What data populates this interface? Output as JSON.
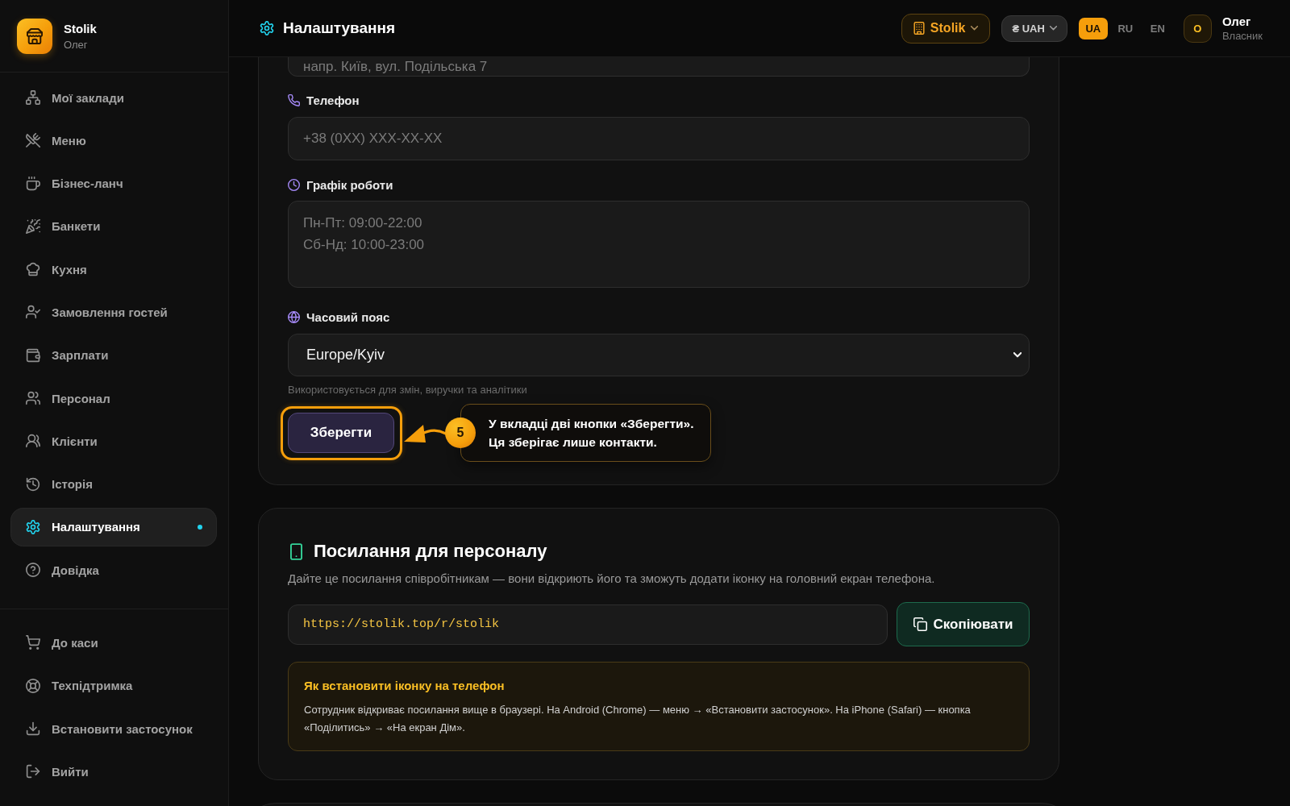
{
  "sidebar": {
    "brand": {
      "name": "Stolik",
      "user": "Олег"
    },
    "items": [
      {
        "label": "Мої заклади",
        "selected": false
      },
      {
        "label": "Меню",
        "selected": false
      },
      {
        "label": "Бізнес-ланч",
        "selected": false
      },
      {
        "label": "Банкети",
        "selected": false
      },
      {
        "label": "Кухня",
        "selected": false
      },
      {
        "label": "Замовлення гостей",
        "selected": false
      },
      {
        "label": "Зарплати",
        "selected": false
      },
      {
        "label": "Персонал",
        "selected": false
      },
      {
        "label": "Клієнти",
        "selected": false
      },
      {
        "label": "Історія",
        "selected": false
      },
      {
        "label": "Налаштування",
        "selected": true
      },
      {
        "label": "Довідка",
        "selected": false
      }
    ],
    "footer_items": [
      {
        "label": "До каси"
      },
      {
        "label": "Техпідтримка"
      },
      {
        "label": "Встановити застосунок"
      },
      {
        "label": "Вийти"
      }
    ]
  },
  "topbar": {
    "title": "Налаштування",
    "venue": {
      "label": "Stolik"
    },
    "currency": {
      "label": "₴ UAH"
    },
    "languages": [
      {
        "label": "UA",
        "selected": true
      },
      {
        "label": "RU",
        "selected": false
      },
      {
        "label": "EN",
        "selected": false
      }
    ],
    "user": {
      "initial": "О",
      "name": "Олег",
      "role": "Власник"
    }
  },
  "contacts_form": {
    "address": {
      "placeholder": "напр. Київ, вул. Подільська 7"
    },
    "phone": {
      "label": "Телефон",
      "placeholder": "+38 (0XX) XXX-XX-XX"
    },
    "hours": {
      "label": "Графік роботи",
      "placeholder": "Пн-Пт: 09:00-22:00\nСб-Нд: 10:00-23:00"
    },
    "timezone": {
      "label": "Часовий пояс",
      "value": "Europe/Kyiv",
      "hint": "Використовується для змін, виручки та аналітики"
    },
    "save_button": {
      "label": "Зберегти"
    }
  },
  "tour_hint": {
    "step": "5",
    "text": "У вкладці дві кнопки «Зберегти».\nЦя зберігає лише контакти."
  },
  "staff_link": {
    "title": "Посилання для персоналу",
    "description": "Дайте це посилання співробітникам — вони відкриють його та зможуть додати іконку на головний екран телефона.",
    "url": "https://stolik.top/r/stolik",
    "copy_button": {
      "label": "Скопіювати"
    },
    "info": {
      "title": "Як встановити іконку на телефон",
      "text": "Сотрудник відкриває посилання вище в браузері. На Android (Chrome) — меню → «Встановити застосунок». На iPhone (Safari) — кнопка «Поділитись» → «На екран Дім»."
    }
  }
}
